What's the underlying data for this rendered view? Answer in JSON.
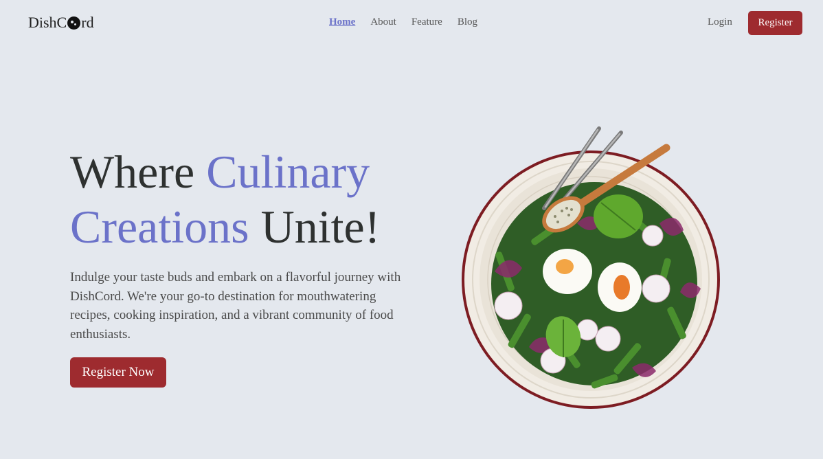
{
  "brand": {
    "name_before": "DishC",
    "name_after": "rd"
  },
  "nav": {
    "items": [
      {
        "label": "Home",
        "active": true
      },
      {
        "label": "About"
      },
      {
        "label": "Feature"
      },
      {
        "label": "Blog"
      }
    ],
    "login_label": "Login",
    "register_label": "Register"
  },
  "hero": {
    "title_part1": "Where ",
    "title_accent1": "Culinary",
    "title_accent2": "Creations",
    "title_part2": " Unite!",
    "description": "Indulge your taste buds and embark on a flavorful journey with DishCord. We're your go-to destination for mouthwatering recipes, cooking inspiration, and a vibrant community of food enthusiasts.",
    "cta_label": "Register Now"
  },
  "colors": {
    "accent": "#6b72c9",
    "brand_red": "#9e2b2f",
    "background": "#e4e8ee"
  },
  "icons": {
    "logo_mark": "cookie-icon"
  }
}
